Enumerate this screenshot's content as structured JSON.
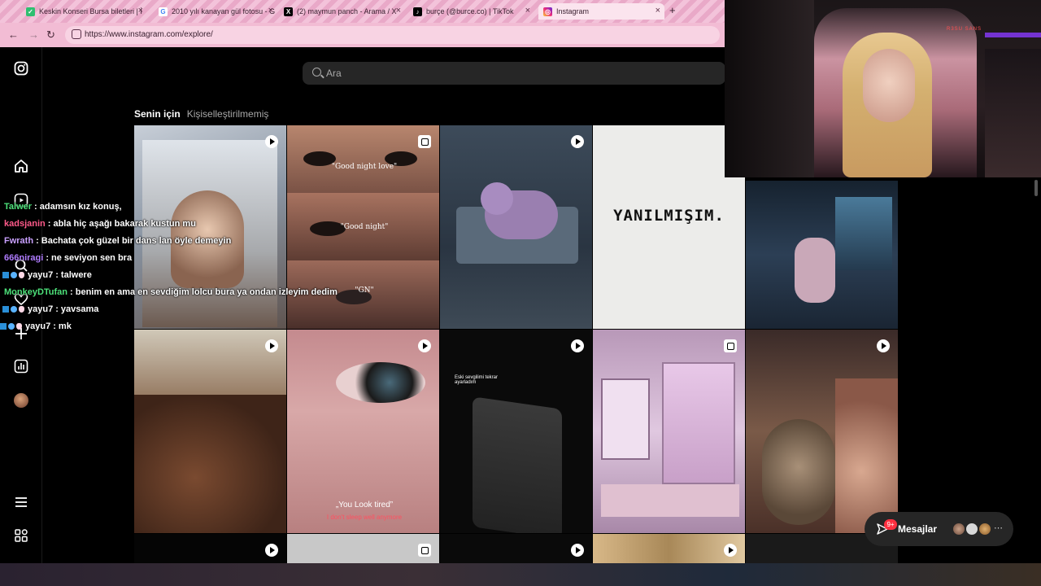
{
  "browser": {
    "tabs": [
      {
        "title": "Keskin Konseri Bursa biletleri | İ",
        "icon": "ticket-icon",
        "color": "#2fbf71"
      },
      {
        "title": "2010 yılı kanayan gül fotosu - G",
        "icon": "google-icon",
        "color": "#4285f4"
      },
      {
        "title": "(2) maymun panch - Arama / X",
        "icon": "x-icon",
        "color": "#000000"
      },
      {
        "title": "burçe (@burce.co) | TikTok",
        "icon": "tiktok-icon",
        "color": "#000000"
      },
      {
        "title": "Instagram",
        "icon": "instagram-icon",
        "color": "#e1306c"
      }
    ],
    "new_tab": "+",
    "url": "https://www.instagram.com/explore/"
  },
  "instagram": {
    "search_placeholder": "Ara",
    "filter_tabs": [
      "Senin için",
      "Kişiselleştirilmemiş"
    ],
    "sidebar_icons": [
      "instagram-logo-icon",
      "home-icon",
      "reels-icon",
      "search-icon",
      "heart-icon",
      "create-icon",
      "insights-icon",
      "profile-avatar",
      "menu-icon",
      "more-apps-icon"
    ],
    "tiles": [
      {
        "kind": "reel",
        "colors": [
          "#8fa0b3",
          "#c9d0d8"
        ],
        "caption": ""
      },
      {
        "kind": "carousel",
        "colors": [
          "#3b2a28",
          "#6d4b44"
        ],
        "captions": [
          "\"Good night love\"",
          "\"Good night\"",
          "\"GN\""
        ]
      },
      {
        "kind": "reel",
        "colors": [
          "#2a3a4a",
          "#4b5b6d"
        ],
        "caption": ""
      },
      {
        "kind": "carousel",
        "colors": [
          "#ececec",
          "#f5f5f5"
        ],
        "caption": "YANILMIŞIM."
      },
      {
        "kind": "reel",
        "colors": [
          "#1a2636",
          "#33475e"
        ],
        "caption": ""
      },
      {
        "kind": "reel",
        "colors": [
          "#6b4a36",
          "#b8a88c"
        ],
        "caption": ""
      },
      {
        "kind": "reel",
        "colors": [
          "#b77d83",
          "#e0b0b0"
        ],
        "caption": "„You Look tired”",
        "subcaption": "I don't sleep well anymore"
      },
      {
        "kind": "reel",
        "colors": [
          "#111111",
          "#2a2a2a"
        ],
        "caption": "Eski sevgilimi tekrar\nayarladım"
      },
      {
        "kind": "carousel",
        "colors": [
          "#c8a8c8",
          "#e8d0e8"
        ],
        "caption": ""
      },
      {
        "kind": "reel",
        "colors": [
          "#5a4038",
          "#a07868"
        ],
        "caption": ""
      }
    ],
    "messages": {
      "label": "Mesajlar",
      "count": "9+"
    }
  },
  "webcam": {
    "tag": "R3SU SANS"
  },
  "chat": [
    {
      "user": "Talwer",
      "color": "#4de27a",
      "msg": ": adamsın kız konuş,"
    },
    {
      "user": "kadsjanin",
      "color": "#ff5a8a",
      "msg": ": abla hiç aşağı bakarak kustun mu"
    },
    {
      "user": "Fwrath",
      "color": "#c9a0ff",
      "msg": ": Bachata çok güzel bir dans lan öyle demeyin"
    },
    {
      "user": "666niragi",
      "color": "#b07cff",
      "msg": ": ne seviyon sen bra"
    },
    {
      "user": "yayu7",
      "color": "#ffffff",
      "msg": ": talwere",
      "badges": true
    },
    {
      "user": "MonkeyDTufan",
      "color": "#4de27a",
      "msg": ": benim en ama en sevdiğim lolcu bura ya ondan izleyim dedim"
    },
    {
      "user": "yayu7",
      "color": "#ffffff",
      "msg": ": yavsama",
      "badges": true
    },
    {
      "user": "yayu7",
      "color": "#ffffff",
      "msg": ": mk",
      "badges": true
    }
  ]
}
